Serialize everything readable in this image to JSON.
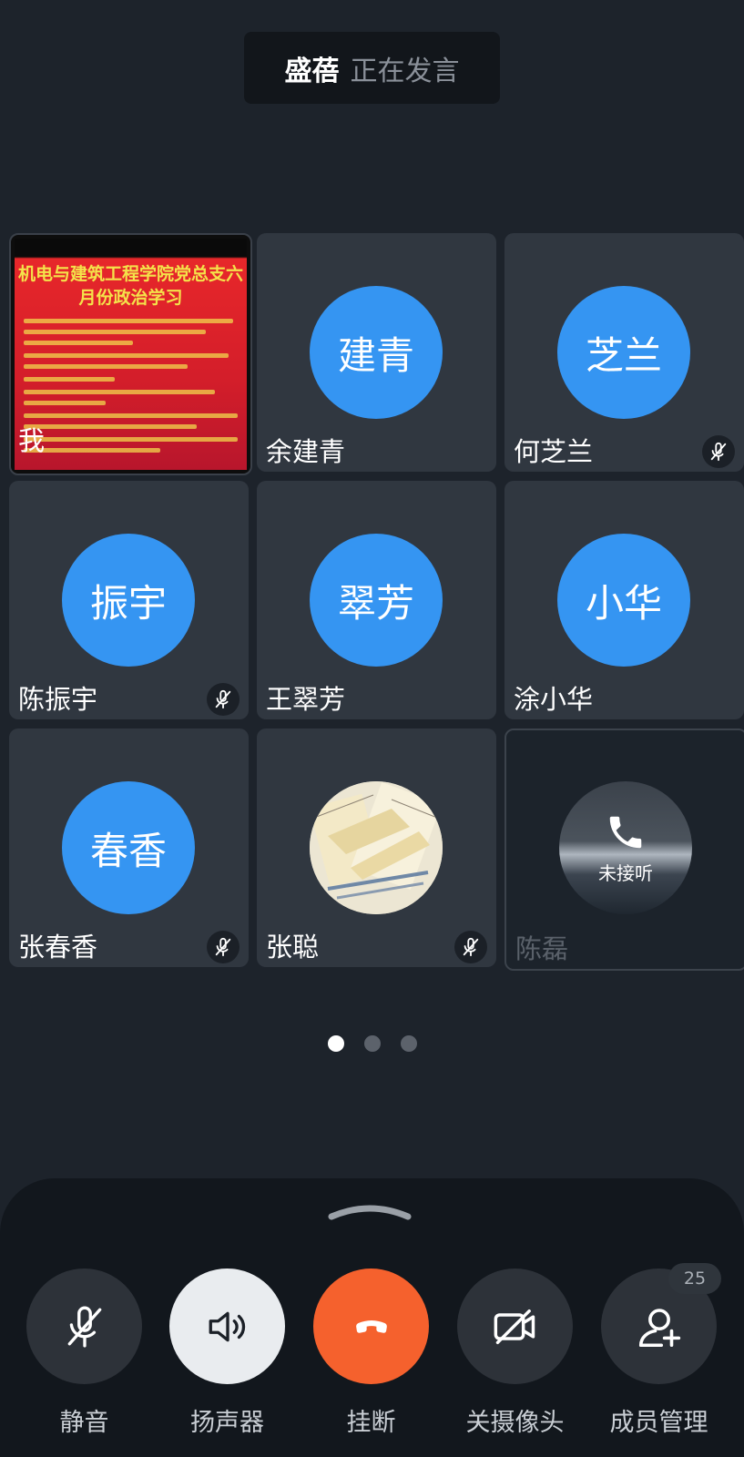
{
  "banner": {
    "speaker": "盛蓓",
    "status": "正在发言"
  },
  "tiles": [
    {
      "name": "我",
      "kind": "video"
    },
    {
      "name": "余建青",
      "initials": "建青",
      "muted": false
    },
    {
      "name": "何芝兰",
      "initials": "芝兰",
      "muted": true
    },
    {
      "name": "陈振宇",
      "initials": "振宇",
      "muted": true
    },
    {
      "name": "王翠芳",
      "initials": "翠芳",
      "muted": false
    },
    {
      "name": "涂小华",
      "initials": "小华",
      "muted": false
    },
    {
      "name": "张春香",
      "initials": "春香",
      "muted": true
    },
    {
      "name": "张聪",
      "kind": "photo",
      "muted": true
    },
    {
      "name": "陈磊",
      "kind": "unanswered",
      "status": "未接听"
    }
  ],
  "slide": {
    "title_line1": "机电与建筑工程学院党总支六",
    "title_line2": "月份政治学习"
  },
  "pager": {
    "pages": 3,
    "current": 1
  },
  "controls": {
    "mute": "静音",
    "speaker": "扬声器",
    "hangup": "挂断",
    "camera_off": "关摄像头",
    "members": "成员管理",
    "member_count": "25"
  },
  "colors": {
    "avatar_blue": "#3595f2",
    "hangup_red": "#f5612d",
    "background": "#1d232b"
  }
}
